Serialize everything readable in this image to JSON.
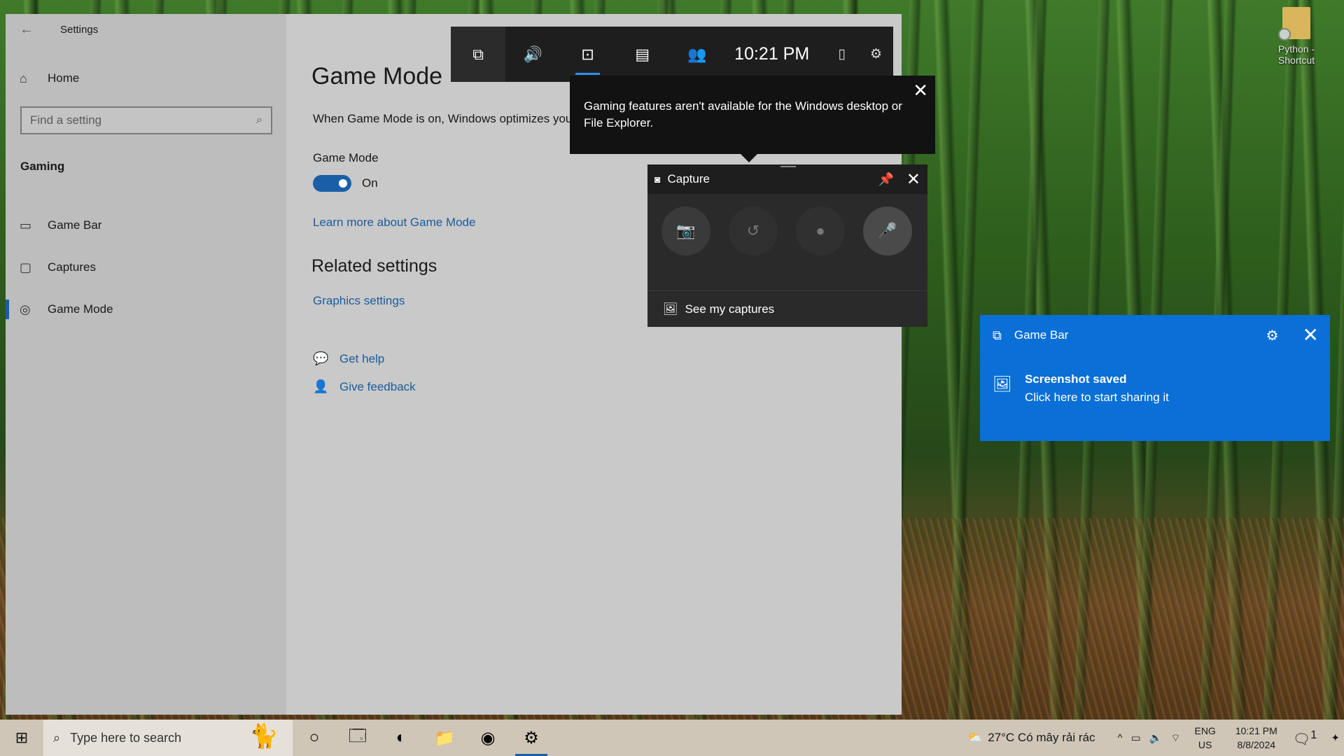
{
  "desktop": {
    "icon_label": "Python - Shortcut"
  },
  "settings": {
    "window_title": "Settings",
    "nav_home": "Home",
    "search_placeholder": "Find a setting",
    "section": "Gaming",
    "nav_items": [
      {
        "label": "Game Bar",
        "icon": "gamebar-icon"
      },
      {
        "label": "Captures",
        "icon": "captures-icon"
      },
      {
        "label": "Game Mode",
        "icon": "gamemode-icon"
      }
    ],
    "page_title": "Game Mode",
    "description": "When Game Mode is on, Windows optimizes you",
    "toggle_label": "Game Mode",
    "toggle_state": "On",
    "learn_more": "Learn more about Game Mode",
    "related_heading": "Related settings",
    "graphics_link": "Graphics settings",
    "get_help": "Get help",
    "give_feedback": "Give feedback",
    "accent_color": "#1b5ea8"
  },
  "gamebar": {
    "time": "10:21 PM",
    "widgets": [
      "widget-menu-icon",
      "audio-icon",
      "capture-icon",
      "performance-icon",
      "xbox-social-icon"
    ],
    "notice_text": "Gaming features aren't available for the Windows desktop or File Explorer."
  },
  "capture": {
    "title": "Capture",
    "see_captures": "See my captures"
  },
  "toast": {
    "app": "Game Bar",
    "title": "Screenshot saved",
    "body": "Click here to start sharing it",
    "color": "#0a6fd6"
  },
  "taskbar": {
    "search_placeholder": "Type here to search",
    "weather": "27°C  Có mây rải rác",
    "lang_line1": "ENG",
    "lang_line2": "US",
    "clock_time": "10:21 PM",
    "clock_date": "8/8/2024",
    "notif_count": "1"
  }
}
